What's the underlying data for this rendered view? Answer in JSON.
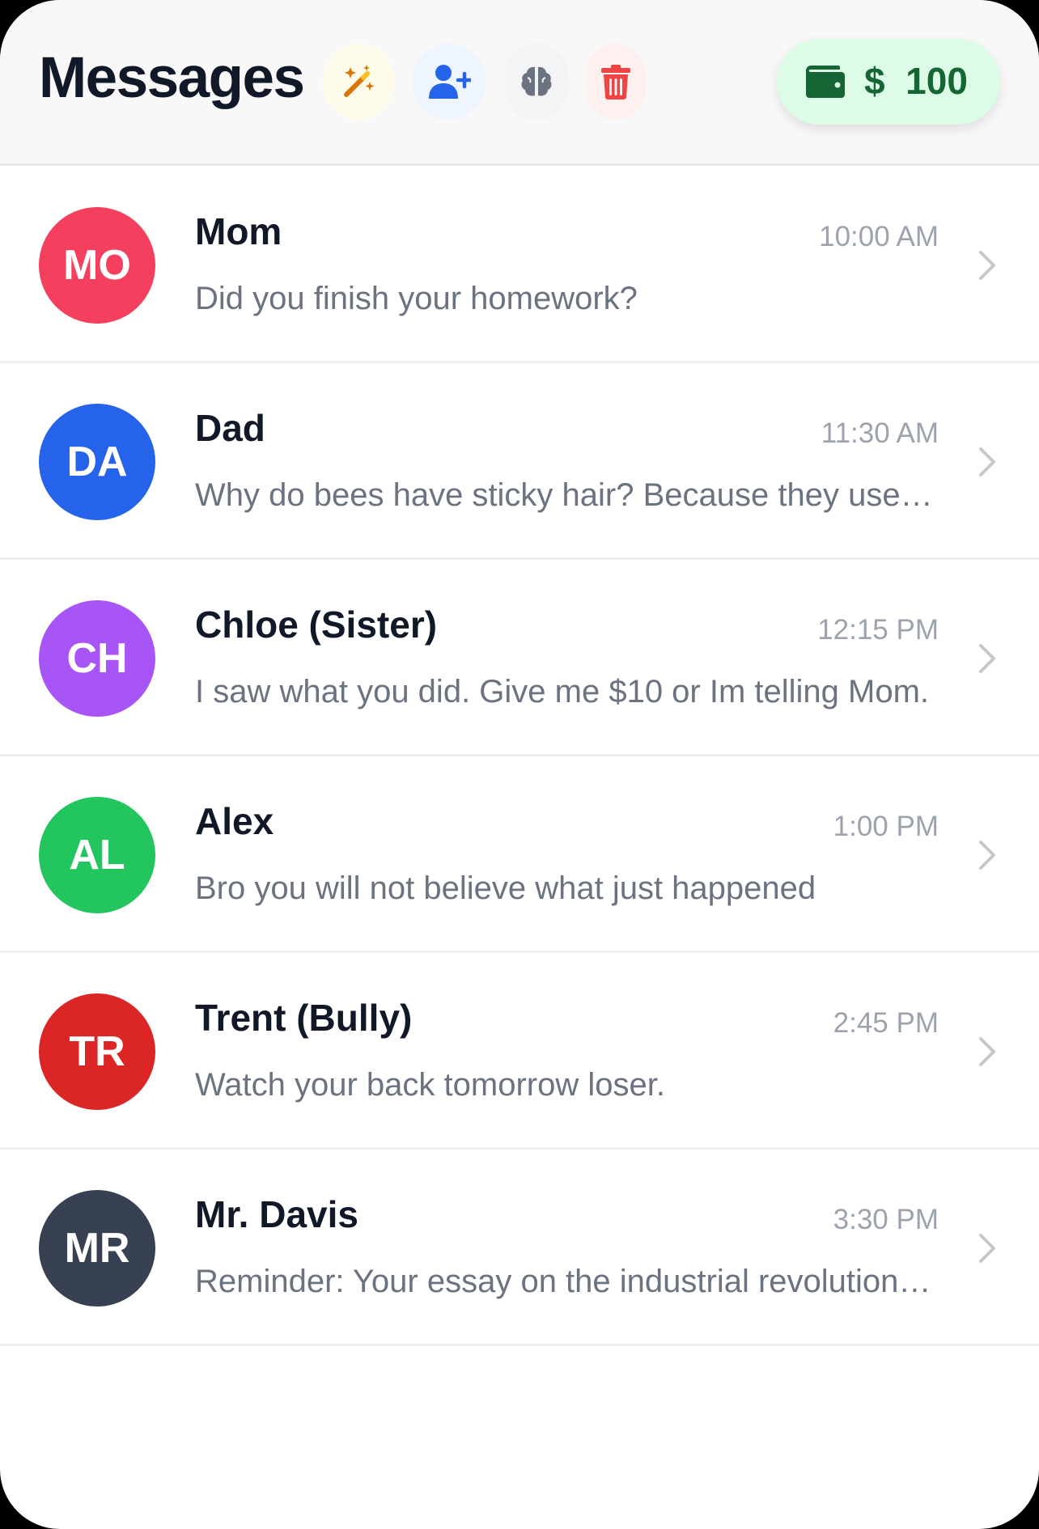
{
  "header": {
    "title": "Messages",
    "buttons": [
      {
        "icon": "magic-wand-icon",
        "color": "#d97706"
      },
      {
        "icon": "add-user-icon",
        "color": "#2563eb"
      },
      {
        "icon": "brain-icon",
        "color": "#6b7280"
      },
      {
        "icon": "trash-icon",
        "color": "#ef4444"
      }
    ],
    "wallet": {
      "icon": "wallet-icon",
      "currency": "$",
      "amount": "100",
      "color": "#166534",
      "background": "#dcfce7"
    }
  },
  "conversations": [
    {
      "initials": "MO",
      "name": "Mom",
      "time": "10:00 AM",
      "preview": "Did you finish your homework?",
      "color": "#f43f5e"
    },
    {
      "initials": "DA",
      "name": "Dad",
      "time": "11:30 AM",
      "preview": "Why do bees have sticky hair? Because they use honeycombs!",
      "color": "#2563eb"
    },
    {
      "initials": "CH",
      "name": "Chloe (Sister)",
      "time": "12:15 PM",
      "preview": "I saw what you did. Give me $10 or Im telling Mom.",
      "color": "#a855f7"
    },
    {
      "initials": "AL",
      "name": "Alex",
      "time": "1:00 PM",
      "preview": "Bro you will not believe what just happened",
      "color": "#22c55e"
    },
    {
      "initials": "TR",
      "name": "Trent (Bully)",
      "time": "2:45 PM",
      "preview": "Watch your back tomorrow loser.",
      "color": "#dc2626"
    },
    {
      "initials": "MR",
      "name": "Mr. Davis",
      "time": "3:30 PM",
      "preview": "Reminder: Your essay on the industrial revolution is due Friday.",
      "color": "#374151"
    }
  ]
}
